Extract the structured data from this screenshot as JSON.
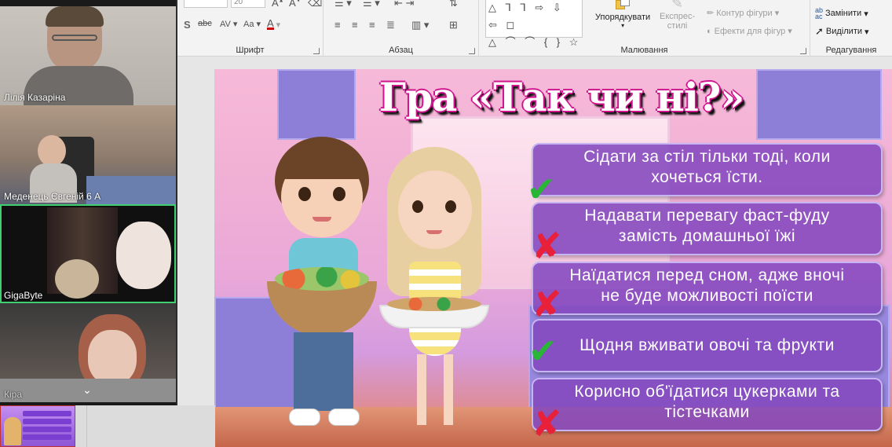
{
  "ribbon": {
    "font": {
      "label": "Шрифт",
      "size_value": "20"
    },
    "paragraph": {
      "label": "Абзац"
    },
    "drawing": {
      "label": "Малювання",
      "arrange": "Упорядкувати",
      "quick_styles_line1": "Експрес-",
      "quick_styles_line2": "стилі",
      "shape_outline": "Контур фігури",
      "shape_effects": "Ефекти для фігур"
    },
    "editing": {
      "label": "Редагування",
      "replace": "Замінити",
      "select": "Виділити"
    }
  },
  "participants": [
    {
      "name": "Лілія Казаріна"
    },
    {
      "name": "Меденець Євгеній 6 А"
    },
    {
      "name": "GigaByte"
    },
    {
      "name": "Кіра"
    }
  ],
  "slide": {
    "title": "Гра «Так чи ні?»",
    "statements": [
      {
        "line1": "Сідати за стіл тільки тоді, коли",
        "line2": "хочеться їсти.",
        "answer": "yes"
      },
      {
        "line1": "Надавати перевагу фаст-фуду",
        "line2": "замість домашньої їжі",
        "answer": "no"
      },
      {
        "line1": "Наїдатися перед сном, адже вночі",
        "line2": "не буде можливості поїсти",
        "answer": "no"
      },
      {
        "line1": "Щодня вживати овочі та фрукти",
        "line2": "",
        "answer": "yes"
      },
      {
        "line1": "Корисно об'їдатися цукерками та",
        "line2": "тістечками",
        "answer": "no"
      }
    ],
    "marks": {
      "yes": "✔",
      "no": "✘"
    }
  },
  "colors": {
    "active_speaker": "#3fcf6e",
    "card_bg": "#8448be",
    "check": "#29b536",
    "cross": "#e8203a"
  }
}
